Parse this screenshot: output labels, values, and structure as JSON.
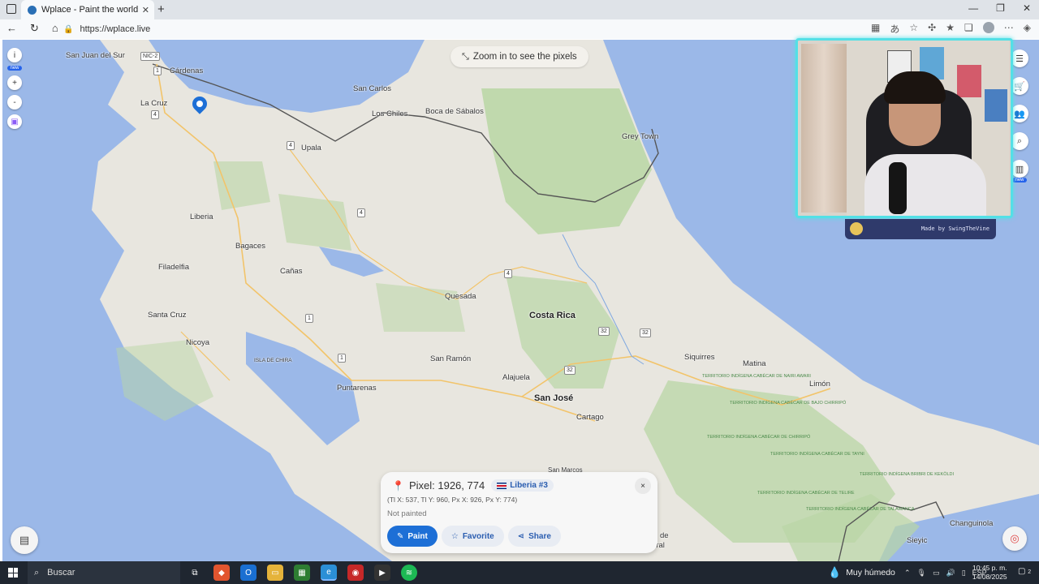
{
  "browser": {
    "tab_title": "Wplace - Paint the world",
    "url": "https://wplace.live",
    "icons": [
      "sidebar-icon",
      "back-icon",
      "refresh-icon",
      "home-icon",
      "lock-icon",
      "apps-icon",
      "translate-icon",
      "star-icon",
      "extensions-icon",
      "favorites-icon",
      "profile-icon",
      "more-icon",
      "copilot-icon"
    ]
  },
  "map": {
    "zoom_hint": "Zoom in to see the pixels",
    "left_tools": {
      "info_label": "i",
      "new_badge": "new",
      "zoom_in": "+",
      "zoom_out": "-"
    },
    "right_tools": {
      "new_badge": "new"
    },
    "places": {
      "san_juan_del_sur": "San Juan del Sur",
      "cardenas": "Cárdenas",
      "la_cruz": "La Cruz",
      "san_carlos": "San Carlos",
      "los_chiles": "Los Chiles",
      "boca_de_sabalos": "Boca de Sábalos",
      "grey_town": "Grey Town",
      "upala": "Upala",
      "liberia": "Liberia",
      "bagaces": "Bagaces",
      "filadelfia": "Filadelfia",
      "canas": "Cañas",
      "santa_cruz": "Santa Cruz",
      "nicoya": "Nicoya",
      "isla_de_chira": "ISLA DE CHIRA",
      "quesada": "Quesada",
      "costa_rica": "Costa Rica",
      "san_ramon": "San Ramón",
      "alajuela": "Alajuela",
      "puntarenas": "Puntarenas",
      "san_jose": "San José",
      "cartago": "Cartago",
      "siquirres": "Siquirres",
      "matina": "Matina",
      "limon": "Limón",
      "changuinola": "Changuinola",
      "sieyic": "Sieyic",
      "san_marcos": "San Marcos",
      "de": "de",
      "eral": "eral",
      "t_nairi": "TERRITORIO INDÍGENA CABÉCAR DE NAIRI AWARI",
      "t_bajo_chirripo": "TERRITORIO INDÍGENA CABÉCAR DE BAJO CHIRRIPÓ",
      "t_chirripo": "TERRITORIO INDÍGENA CABÉCAR DE CHIRRIPÓ",
      "t_tayni": "TERRITORIO INDÍGENA CABÉCAR DE TAYNI",
      "t_telire": "TERRITORIO INDÍGENA CABÉCAR DE TELIRE",
      "t_talamanca": "TERRITORIO INDÍGENA CABÉCAR DE TALAMANCA",
      "t_keköldi": "TERRITORIO INDÍGENA BRIBRI DE KEKÖLDI"
    },
    "road_labels": {
      "nic2": "NIC-2",
      "r1_north": "1",
      "r4_lacruz": "4",
      "r4_upala": "4",
      "r4_mid": "4",
      "r4_east": "4",
      "r1_bagaces": "1",
      "r1_south": "1",
      "r32_a": "32",
      "r32_b": "32",
      "r32_c": "32"
    }
  },
  "pixel_panel": {
    "title": "Pixel: 1926, 774",
    "region": "Liberia #3",
    "coords": "(Tl X: 537, Tl Y: 960, Px X: 926, Px Y: 774)",
    "status": "Not painted",
    "close": "×",
    "paint_label": "Paint",
    "favorite_label": "Favorite",
    "share_label": "Share"
  },
  "webcam": {
    "credit": "Made by SwingTheVine"
  },
  "taskbar": {
    "search_placeholder": "Buscar",
    "weather": "Muy húmedo",
    "language": "ESP",
    "time": "10:45 p. m.",
    "date": "14/08/2025",
    "notifications": "2"
  },
  "colors": {
    "accent": "#1d6fd6",
    "water": "#9bb8e8",
    "land": "#e8e6df",
    "forest": "#b9d6a5",
    "webcam_border": "#53e0e6"
  }
}
